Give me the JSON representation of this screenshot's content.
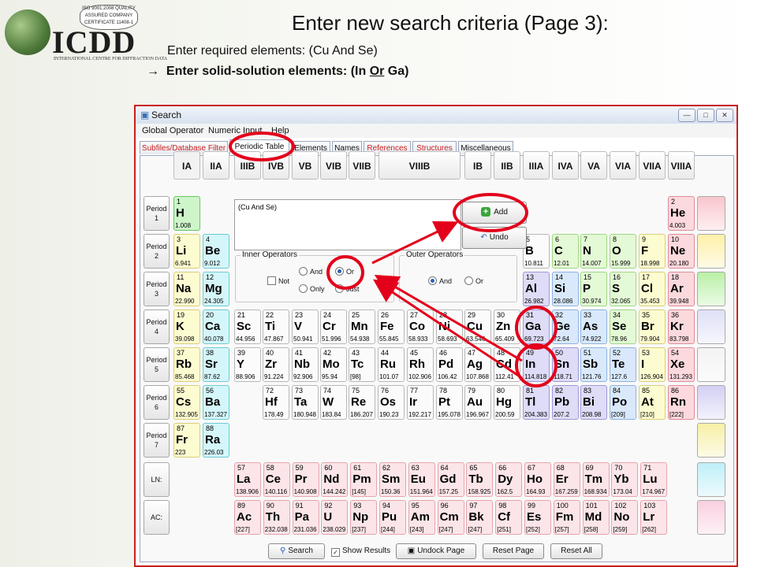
{
  "slide": {
    "title": "Enter new search criteria (Page 3):",
    "line1": "Enter required elements: (Cu And Se)",
    "line2_arrow": "→",
    "line2_pre": "Enter solid-solution elements: (In ",
    "line2_or": "Or",
    "line2_post": " Ga)"
  },
  "logo": {
    "badge": "ISO 9001:2008 QUALITY ASSURED COMPANY CERTIFICATE 11408-1",
    "word": "ICDD",
    "sub": "INTERNATIONAL CENTRE FOR DIFFRACTION DATA"
  },
  "window": {
    "title": "Search",
    "menu": [
      "Global Operator",
      "Numeric Input",
      "Help"
    ],
    "tabs": [
      "Subfiles/Database Filter",
      "Periodic Table",
      "Elements",
      "Names",
      "References",
      "Structures",
      "Miscellaneous"
    ],
    "active_tab": "Periodic Table",
    "criteria_text": "(Cu And Se)",
    "add_label": "Add",
    "undo_label": "Undo",
    "inner_title": "Inner Operators",
    "outer_title": "Outer Operators",
    "not_label": "Not",
    "and_label": "And",
    "or_label": "Or",
    "only_label": "Only",
    "just_label": "Just",
    "search_label": "Search",
    "show_results_label": "Show Results",
    "undock_label": "Undock Page",
    "reset_page_label": "Reset Page",
    "reset_all_label": "Reset All",
    "inner_selected": "Or",
    "outer_selected": "And"
  },
  "groups": [
    "IA",
    "IIA",
    "IIIB",
    "IVB",
    "VB",
    "VIB",
    "VIIB",
    "VIIIB",
    "IB",
    "IIB",
    "IIIA",
    "IVA",
    "VA",
    "VIA",
    "VIIA",
    "VIIIA"
  ],
  "periods": [
    {
      "l1": "Period",
      "l2": "1"
    },
    {
      "l1": "Period",
      "l2": "2"
    },
    {
      "l1": "Period",
      "l2": "3"
    },
    {
      "l1": "Period",
      "l2": "4"
    },
    {
      "l1": "Period",
      "l2": "5"
    },
    {
      "l1": "Period",
      "l2": "6"
    },
    {
      "l1": "Period",
      "l2": "7"
    },
    {
      "l1": "LN:",
      "l2": ""
    },
    {
      "l1": "AC:",
      "l2": ""
    }
  ],
  "elements": {
    "H": [
      "1",
      "H",
      "1.008"
    ],
    "He": [
      "2",
      "He",
      "4.003"
    ],
    "Li": [
      "3",
      "Li",
      "6.941"
    ],
    "Be": [
      "4",
      "Be",
      "9.012"
    ],
    "B": [
      "5",
      "B",
      "10.811"
    ],
    "C": [
      "6",
      "C",
      "12.01"
    ],
    "N": [
      "7",
      "N",
      "14.007"
    ],
    "O": [
      "8",
      "O",
      "15.999"
    ],
    "F": [
      "9",
      "F",
      "18.998"
    ],
    "Ne": [
      "10",
      "Ne",
      "20.180"
    ],
    "Na": [
      "11",
      "Na",
      "22.990"
    ],
    "Mg": [
      "12",
      "Mg",
      "24.305"
    ],
    "Al": [
      "13",
      "Al",
      "26.982"
    ],
    "Si": [
      "14",
      "Si",
      "28.086"
    ],
    "P": [
      "15",
      "P",
      "30.974"
    ],
    "S": [
      "16",
      "S",
      "32.065"
    ],
    "Cl": [
      "17",
      "Cl",
      "35.453"
    ],
    "Ar": [
      "18",
      "Ar",
      "39.948"
    ],
    "K": [
      "19",
      "K",
      "39.098"
    ],
    "Ca": [
      "20",
      "Ca",
      "40.078"
    ],
    "Sc": [
      "21",
      "Sc",
      "44.956"
    ],
    "Ti": [
      "22",
      "Ti",
      "47.867"
    ],
    "V": [
      "23",
      "V",
      "50.941"
    ],
    "Cr": [
      "24",
      "Cr",
      "51.996"
    ],
    "Mn": [
      "25",
      "Mn",
      "54.938"
    ],
    "Fe": [
      "26",
      "Fe",
      "55.845"
    ],
    "Co": [
      "27",
      "Co",
      "58.933"
    ],
    "Ni": [
      "28",
      "Ni",
      "58.693"
    ],
    "Cu": [
      "29",
      "Cu",
      "63.546"
    ],
    "Zn": [
      "30",
      "Zn",
      "65.409"
    ],
    "Ga": [
      "31",
      "Ga",
      "69.723"
    ],
    "Ge": [
      "32",
      "Ge",
      "72.64"
    ],
    "As": [
      "33",
      "As",
      "74.922"
    ],
    "Se": [
      "34",
      "Se",
      "78.96"
    ],
    "Br": [
      "35",
      "Br",
      "79.904"
    ],
    "Kr": [
      "36",
      "Kr",
      "83.798"
    ],
    "Rb": [
      "37",
      "Rb",
      "85.468"
    ],
    "Sr": [
      "38",
      "Sr",
      "87.62"
    ],
    "Y": [
      "39",
      "Y",
      "88.906"
    ],
    "Zr": [
      "40",
      "Zr",
      "91.224"
    ],
    "Nb": [
      "41",
      "Nb",
      "92.906"
    ],
    "Mo": [
      "42",
      "Mo",
      "95.94"
    ],
    "Tc": [
      "43",
      "Tc",
      "[98]"
    ],
    "Ru": [
      "44",
      "Ru",
      "101.07"
    ],
    "Rh": [
      "45",
      "Rh",
      "102.906"
    ],
    "Pd": [
      "46",
      "Pd",
      "106.42"
    ],
    "Ag": [
      "47",
      "Ag",
      "107.868"
    ],
    "Cd": [
      "48",
      "Cd",
      "112.41"
    ],
    "In": [
      "49",
      "In",
      "114.818"
    ],
    "Sn": [
      "50",
      "Sn",
      "118.71"
    ],
    "Sb": [
      "51",
      "Sb",
      "121.76"
    ],
    "Te": [
      "52",
      "Te",
      "127.6"
    ],
    "I": [
      "53",
      "I",
      "126.904"
    ],
    "Xe": [
      "54",
      "Xe",
      "131.293"
    ],
    "Cs": [
      "55",
      "Cs",
      "132.905"
    ],
    "Ba": [
      "56",
      "Ba",
      "137.327"
    ],
    "Hf": [
      "72",
      "Hf",
      "178.49"
    ],
    "Ta": [
      "73",
      "Ta",
      "180.948"
    ],
    "W": [
      "74",
      "W",
      "183.84"
    ],
    "Re": [
      "75",
      "Re",
      "186.207"
    ],
    "Os": [
      "76",
      "Os",
      "190.23"
    ],
    "Ir": [
      "77",
      "Ir",
      "192.217"
    ],
    "Pt": [
      "78",
      "Pt",
      "195.078"
    ],
    "Au": [
      "79",
      "Au",
      "196.967"
    ],
    "Hg": [
      "80",
      "Hg",
      "200.59"
    ],
    "Tl": [
      "81",
      "Tl",
      "204.383"
    ],
    "Pb": [
      "82",
      "Pb",
      "207.2"
    ],
    "Bi": [
      "83",
      "Bi",
      "208.98"
    ],
    "Po": [
      "84",
      "Po",
      "[209]"
    ],
    "At": [
      "85",
      "At",
      "[210]"
    ],
    "Rn": [
      "86",
      "Rn",
      "[222]"
    ],
    "Fr": [
      "87",
      "Fr",
      "223"
    ],
    "Ra": [
      "88",
      "Ra",
      "226.03"
    ],
    "La": [
      "57",
      "La",
      "138.906"
    ],
    "Ce": [
      "58",
      "Ce",
      "140.116"
    ],
    "Pr": [
      "59",
      "Pr",
      "140.908"
    ],
    "Nd": [
      "60",
      "Nd",
      "144.242"
    ],
    "Pm": [
      "61",
      "Pm",
      "[145]"
    ],
    "Sm": [
      "62",
      "Sm",
      "150.36"
    ],
    "Eu": [
      "63",
      "Eu",
      "151.964"
    ],
    "Gd": [
      "64",
      "Gd",
      "157.25"
    ],
    "Tb": [
      "65",
      "Tb",
      "158.925"
    ],
    "Dy": [
      "66",
      "Dy",
      "162.5"
    ],
    "Ho": [
      "67",
      "Ho",
      "164.93"
    ],
    "Er": [
      "68",
      "Er",
      "167.259"
    ],
    "Tm": [
      "69",
      "Tm",
      "168.934"
    ],
    "Yb": [
      "70",
      "Yb",
      "173.04"
    ],
    "Lu": [
      "71",
      "Lu",
      "174.967"
    ],
    "Ac": [
      "89",
      "Ac",
      "[227]"
    ],
    "Th": [
      "90",
      "Th",
      "232.038"
    ],
    "Pa": [
      "91",
      "Pa",
      "231.036"
    ],
    "U": [
      "92",
      "U",
      "238.029"
    ],
    "Np": [
      "93",
      "Np",
      "[237]"
    ],
    "Pu": [
      "94",
      "Pu",
      "[244]"
    ],
    "Am": [
      "95",
      "Am",
      "[243]"
    ],
    "Cm": [
      "96",
      "Cm",
      "[247]"
    ],
    "Bk": [
      "97",
      "Bk",
      "[247]"
    ],
    "Cf": [
      "98",
      "Cf",
      "[251]"
    ],
    "Es": [
      "99",
      "Es",
      "[252]"
    ],
    "Fm": [
      "100",
      "Fm",
      "[257]"
    ],
    "Md": [
      "101",
      "Md",
      "[258]"
    ],
    "No": [
      "102",
      "No",
      "[259]"
    ],
    "Lr": [
      "103",
      "Lr",
      "[262]"
    ]
  },
  "colors": {
    "annotation_red": "#e3001b",
    "window_border": "#c8201e"
  }
}
